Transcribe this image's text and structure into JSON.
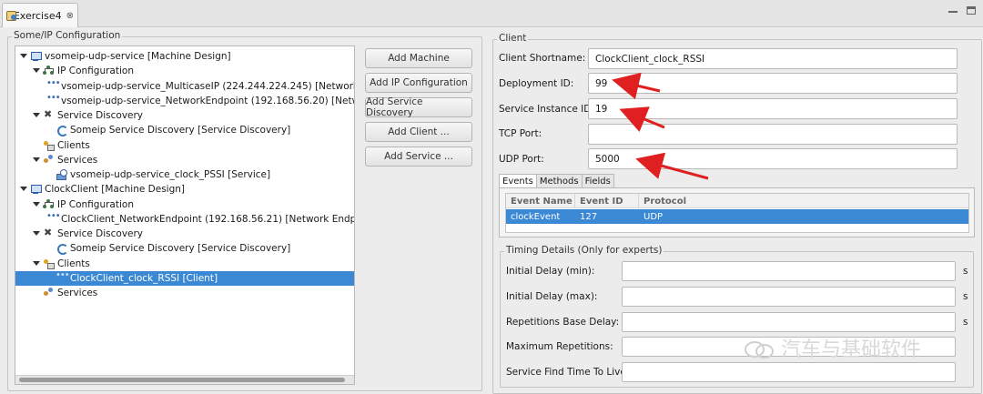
{
  "tab": {
    "title": "Exercise4",
    "close_glyph": "⊗"
  },
  "config_group": {
    "title": "Some/IP Configuration"
  },
  "client_group": {
    "title": "Client"
  },
  "tree": [
    {
      "label": "vsomeip-udp-service [Machine Design]",
      "icon": "machine-icon",
      "level": 0,
      "expanded": true
    },
    {
      "label": "IP Configuration",
      "icon": "ip-config-icon",
      "level": 1,
      "expanded": true
    },
    {
      "label": "vsomeip-udp-service_MulticaseIP (224.244.224.245)  [Network Er",
      "icon": "endpoint-icon",
      "level": 2
    },
    {
      "label": "vsomeip-udp-service_NetworkEndpoint (192.168.56.20)  [Networ",
      "icon": "endpoint-icon",
      "level": 2
    },
    {
      "label": "Service Discovery",
      "icon": "service-discovery-icon",
      "level": 1,
      "expanded": true
    },
    {
      "label": "Someip Service Discovery [Service Discovery]",
      "icon": "service-discovery-leaf-icon",
      "level": 2
    },
    {
      "label": "Clients",
      "icon": "clients-icon",
      "level": 1
    },
    {
      "label": "Services",
      "icon": "services-icon",
      "level": 1,
      "expanded": true
    },
    {
      "label": "vsomeip-udp-service_clock_PSSI [Service]",
      "icon": "service-icon",
      "level": 2
    },
    {
      "label": "ClockClient [Machine Design]",
      "icon": "machine-icon",
      "level": 0,
      "expanded": true
    },
    {
      "label": "IP Configuration",
      "icon": "ip-config-icon",
      "level": 1,
      "expanded": true
    },
    {
      "label": "ClockClient_NetworkEndpoint (192.168.56.21)  [Network Endpoin",
      "icon": "endpoint-icon",
      "level": 2
    },
    {
      "label": "Service Discovery",
      "icon": "service-discovery-icon",
      "level": 1,
      "expanded": true
    },
    {
      "label": "Someip Service Discovery [Service Discovery]",
      "icon": "service-discovery-leaf-icon",
      "level": 2
    },
    {
      "label": "Clients",
      "icon": "clients-icon",
      "level": 1,
      "expanded": true
    },
    {
      "label": "ClockClient_clock_RSSI [Client]",
      "icon": "client-icon",
      "level": 2,
      "selected": true
    },
    {
      "label": "Services",
      "icon": "services-icon",
      "level": 1
    }
  ],
  "buttons": {
    "add_machine": "Add Machine",
    "add_ip_configuration": "Add IP Configuration",
    "add_service_discovery": "Add Service Discovery",
    "add_client": "Add Client ...",
    "add_service": "Add Service ..."
  },
  "client": {
    "shortname_label": "Client Shortname:",
    "shortname_value": "ClockClient_clock_RSSI",
    "deployment_id_label": "Deployment ID:",
    "deployment_id_value": "99",
    "service_instance_id_label": "Service Instance ID:",
    "service_instance_id_value": "19",
    "tcp_port_label": "TCP Port:",
    "tcp_port_value": "",
    "udp_port_label": "UDP Port:",
    "udp_port_value": "5000"
  },
  "subtabs": [
    "Events",
    "Methods",
    "Fields"
  ],
  "events_table": {
    "headers": [
      "Event Name",
      "Event ID",
      "Protocol"
    ],
    "rows": [
      [
        "clockEvent",
        "127",
        "UDP"
      ]
    ]
  },
  "timing": {
    "title": "Timing Details (Only for experts)",
    "initial_delay_min_label": "Initial Delay (min):",
    "initial_delay_max_label": "Initial Delay (max):",
    "repetitions_base_delay_label": "Repetitions Base Delay:",
    "maximum_repetitions_label": "Maximum Repetitions:",
    "service_find_time_label": "Service Find Time To Live:",
    "unit": "s"
  },
  "watermark": {
    "text": "汽车与基础软件"
  },
  "colors": {
    "selection": "#3b89d4",
    "annotation_arrow": "#e02020"
  }
}
